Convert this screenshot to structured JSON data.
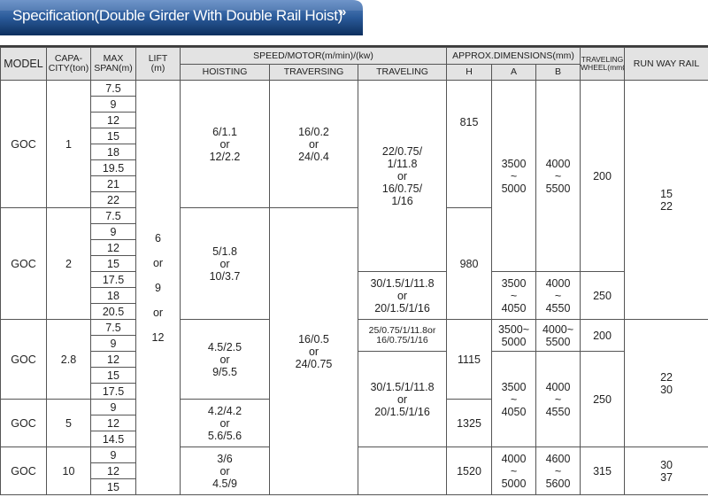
{
  "header": {
    "title": "Specification(Double Girder With Double Rail Hoist)",
    "chevron": "»"
  },
  "columns": {
    "model": "MODEL",
    "capacity": "CAPA-\nCITY(ton)",
    "max_span": "MAX\nSPAN(m)",
    "lift": "LIFT\n(m)",
    "speed_group": "SPEED/MOTOR(m/min)/(kw)",
    "hoisting": "HOISTING",
    "traversing": "TRAVERSING",
    "traveling": "TRAVELING",
    "dim_group": "APPROX.DIMENSIONS(mm)",
    "h": "H",
    "a": "A",
    "b": "B",
    "wheel": "TRAVELING\nWHEEL(mmØ)",
    "rail": "RUN WAY RAIL"
  },
  "rows": {
    "r1": {
      "model": "GOC",
      "capacity": "1",
      "spans": [
        "7.5",
        "9",
        "12",
        "15",
        "18",
        "19.5",
        "21",
        "22"
      ],
      "hoisting": "6/1.1\nor\n12/2.2",
      "h": "815"
    },
    "r2": {
      "model": "GOC",
      "capacity": "2",
      "spans": [
        "7.5",
        "9",
        "12",
        "15",
        "17.5",
        "18",
        "20.5"
      ],
      "hoisting": "5/1.8\nor\n10/3.7",
      "h": "980"
    },
    "r3": {
      "model": "GOC",
      "capacity": "2.8",
      "spans": [
        "7.5",
        "9",
        "12",
        "15",
        "17.5"
      ],
      "hoisting": "4.5/2.5\nor\n9/5.5"
    },
    "r4": {
      "model": "GOC",
      "capacity": "5",
      "spans": [
        "9",
        "12",
        "14.5"
      ],
      "hoisting": "4.2/4.2\nor\n5.6/5.6",
      "h": "1325"
    },
    "r5": {
      "model": "GOC",
      "capacity": "10",
      "spans": [
        "9",
        "12",
        "15"
      ],
      "hoisting": "3/6\nor\n4.5/9",
      "traveling": "",
      "h": "1520",
      "a": "4000\n~\n5000",
      "b": "4600\n~\n5600",
      "wheel": "315",
      "rail": "30\n37"
    }
  },
  "merged": {
    "lift": "6\n\nor\n\n9\n\nor\n\n12",
    "traversing_top": "16/0.2\nor\n24/0.4",
    "traversing_bottom": "16/0.5\nor\n24/0.75",
    "traveling_top": "22/0.75/\n1/11.8\nor\n16/0.75/\n1/16",
    "traveling_mid": "30/1.5/1/11.8\nor\n20/1.5/1/16",
    "traveling_28": "25/0.75/1/11.8or\n16/0.75/1/16",
    "traveling_lower": "30/1.5/1/11.8\nor\n20/1.5/1/16",
    "h_28": "1115",
    "a_top": "3500\n~\n5000",
    "b_top": "4000\n~\n5500",
    "a_mid": "3500\n~\n4050",
    "b_mid": "4000\n~\n4550",
    "a_28": "3500~\n5000",
    "b_28": "4000~\n5500",
    "a_lower": "3500\n~\n4050",
    "b_lower": "4000\n~\n4550",
    "wheel_top": "200",
    "wheel_mid": "250",
    "wheel_28": "200",
    "wheel_lower": "250",
    "rail_top": "15\n22",
    "rail_mid": "22\n30"
  },
  "colors": {
    "banner_dark": "#0d2f5e",
    "banner_light": "#3a6fb0",
    "header_bg": "#e3e3e3"
  }
}
